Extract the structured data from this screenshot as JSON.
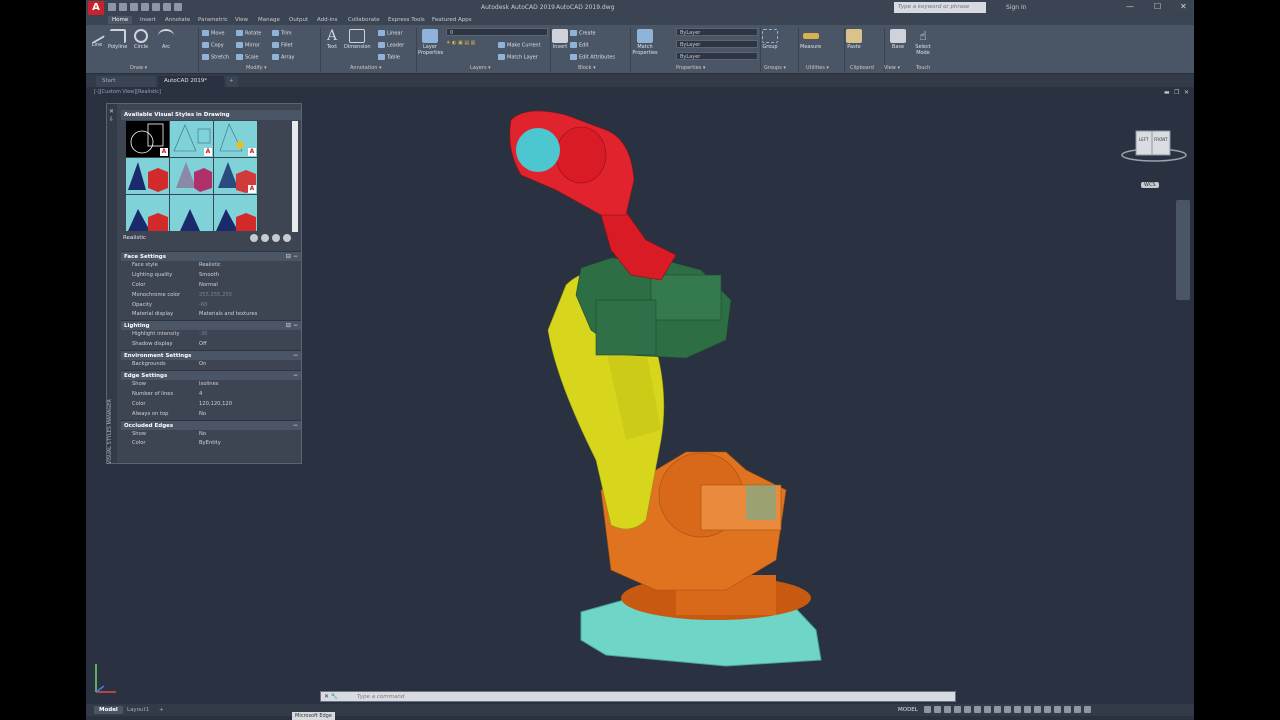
{
  "window": {
    "app_title": "Autodesk AutoCAD 2019",
    "file_title": "AutoCAD 2019.dwg",
    "search_placeholder": "Type a keyword or phrase",
    "sign_in": "Sign In",
    "minimize": "—",
    "maximize": "☐",
    "close": "✕"
  },
  "ribbon_tabs": [
    "Home",
    "Insert",
    "Annotate",
    "Parametric",
    "View",
    "Manage",
    "Output",
    "Add-ins",
    "Collaborate",
    "Express Tools",
    "Featured Apps"
  ],
  "ribbon": {
    "draw": {
      "title": "Draw ▾",
      "line": "Line",
      "polyline": "Polyline",
      "circle": "Circle",
      "arc": "Arc"
    },
    "modify": {
      "title": "Modify ▾",
      "move": "Move",
      "rotate": "Rotate",
      "trim": "Trim",
      "copy": "Copy",
      "mirror": "Mirror",
      "fillet": "Fillet",
      "stretch": "Stretch",
      "scale": "Scale",
      "array": "Array"
    },
    "annotation": {
      "title": "Annotation ▾",
      "text": "Text",
      "dimension": "Dimension",
      "linear": "Linear",
      "leader": "Leader",
      "table": "Table"
    },
    "layers": {
      "title": "Layers ▾",
      "layer_properties": "Layer Properties",
      "make_current": "Make Current",
      "match_layer": "Match Layer",
      "current_layer": "0"
    },
    "block": {
      "title": "Block ▾",
      "insert": "Insert",
      "create": "Create",
      "edit": "Edit",
      "edit_attributes": "Edit Attributes"
    },
    "properties": {
      "title": "Properties ▾",
      "match_properties": "Match Properties",
      "color": "ByLayer",
      "linetype": "ByLayer",
      "lineweight": "ByLayer"
    },
    "groups": {
      "title": "Groups ▾",
      "group": "Group"
    },
    "utilities": {
      "title": "Utilities ▾",
      "measure": "Measure"
    },
    "clipboard": {
      "title": "Clipboard",
      "paste": "Paste"
    },
    "view": {
      "title": "View ▾",
      "base": "Base"
    },
    "touch": {
      "title": "Touch",
      "select_mode": "Select Mode"
    }
  },
  "doc_tabs": [
    "Start",
    "AutoCAD 2019*"
  ],
  "viewport_label": "[-][Custom View][Realistic]",
  "visual_styles": {
    "header": "Available Visual Styles in Drawing",
    "strip_title": "VISUAL STYLES MANAGER",
    "current_style": "Realistic",
    "sections": [
      {
        "title": "Face Settings",
        "rows": [
          {
            "k": "Face style",
            "v": "Realistic"
          },
          {
            "k": "Lighting quality",
            "v": "Smooth"
          },
          {
            "k": "Color",
            "v": "Normal"
          },
          {
            "k": "Monochrome color",
            "v": "255,255,255"
          },
          {
            "k": "Opacity",
            "v": "-60"
          },
          {
            "k": "Material display",
            "v": "Materials and textures"
          }
        ]
      },
      {
        "title": "Lighting",
        "rows": [
          {
            "k": "Highlight intensity",
            "v": "-30"
          },
          {
            "k": "Shadow display",
            "v": "Off"
          }
        ]
      },
      {
        "title": "Environment Settings",
        "rows": [
          {
            "k": "Backgrounds",
            "v": "On"
          }
        ]
      },
      {
        "title": "Edge Settings",
        "rows": [
          {
            "k": "Show",
            "v": "Isolines"
          },
          {
            "k": "Number of lines",
            "v": "4"
          },
          {
            "k": "Color",
            "v": "120,120,120"
          },
          {
            "k": "Always on top",
            "v": "No"
          }
        ]
      },
      {
        "title": "Occluded Edges",
        "rows": [
          {
            "k": "Show",
            "v": "No"
          },
          {
            "k": "Color",
            "v": "ByEntity"
          }
        ]
      }
    ]
  },
  "viewcube": {
    "left": "LEFT",
    "front": "FRONT",
    "wcs": "WCS"
  },
  "command_line": {
    "placeholder": "Type a command"
  },
  "taskbar_tooltip": "Microsoft Edge",
  "status": {
    "model_tab": "Model",
    "layout_tab": "Layout1",
    "add": "+",
    "space": "MODEL"
  }
}
